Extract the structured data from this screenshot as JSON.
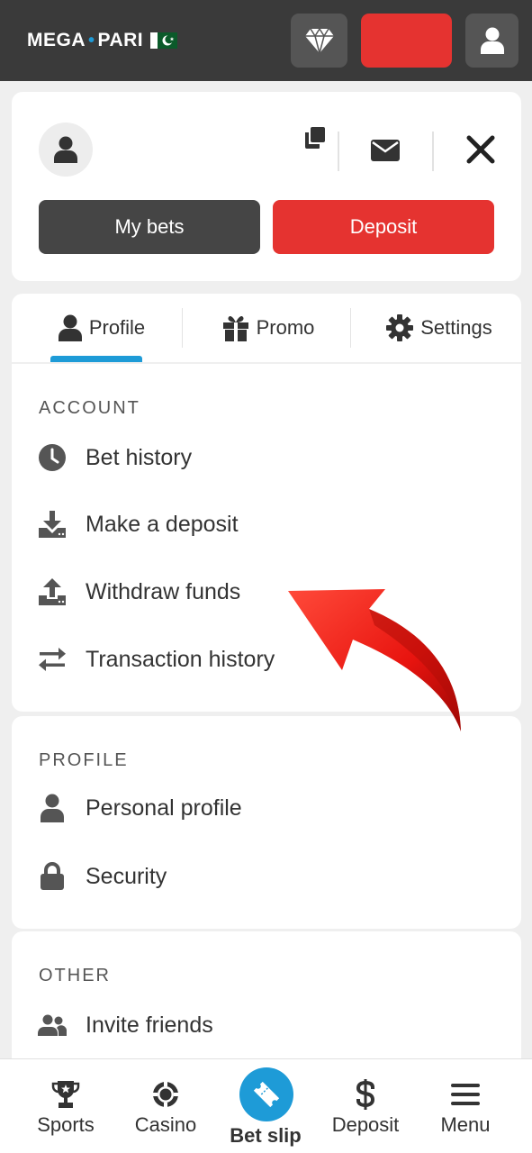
{
  "header": {
    "logo_left": "MEGA",
    "logo_dot": "•",
    "logo_right": "PARI"
  },
  "account_card": {
    "my_bets_label": "My bets",
    "deposit_label": "Deposit"
  },
  "tabs": [
    {
      "label": "Profile",
      "icon": "user-icon",
      "active": true
    },
    {
      "label": "Promo",
      "icon": "gift-icon",
      "active": false
    },
    {
      "label": "Settings",
      "icon": "gear-icon",
      "active": false
    }
  ],
  "sections": {
    "account": {
      "title": "ACCOUNT",
      "items": [
        {
          "label": "Bet history",
          "icon": "clock-icon"
        },
        {
          "label": "Make a deposit",
          "icon": "download-icon"
        },
        {
          "label": "Withdraw funds",
          "icon": "upload-icon"
        },
        {
          "label": "Transaction history",
          "icon": "transfer-arrows-icon"
        }
      ]
    },
    "profile": {
      "title": "PROFILE",
      "items": [
        {
          "label": "Personal profile",
          "icon": "user-icon"
        },
        {
          "label": "Security",
          "icon": "lock-icon"
        }
      ]
    },
    "other": {
      "title": "OTHER",
      "items": [
        {
          "label": "Invite friends",
          "icon": "users-icon"
        }
      ]
    }
  },
  "bottom_nav": [
    {
      "label": "Sports",
      "icon": "trophy-icon"
    },
    {
      "label": "Casino",
      "icon": "chip-icon"
    },
    {
      "label": "Bet slip",
      "icon": "ticket-icon"
    },
    {
      "label": "Deposit",
      "icon": "dollar-icon"
    },
    {
      "label": "Menu",
      "icon": "hamburger-icon"
    }
  ],
  "colors": {
    "header_bg": "#3a3a3a",
    "accent_red": "#e53330",
    "accent_blue": "#1e9bd7",
    "dark_button": "#454545"
  }
}
